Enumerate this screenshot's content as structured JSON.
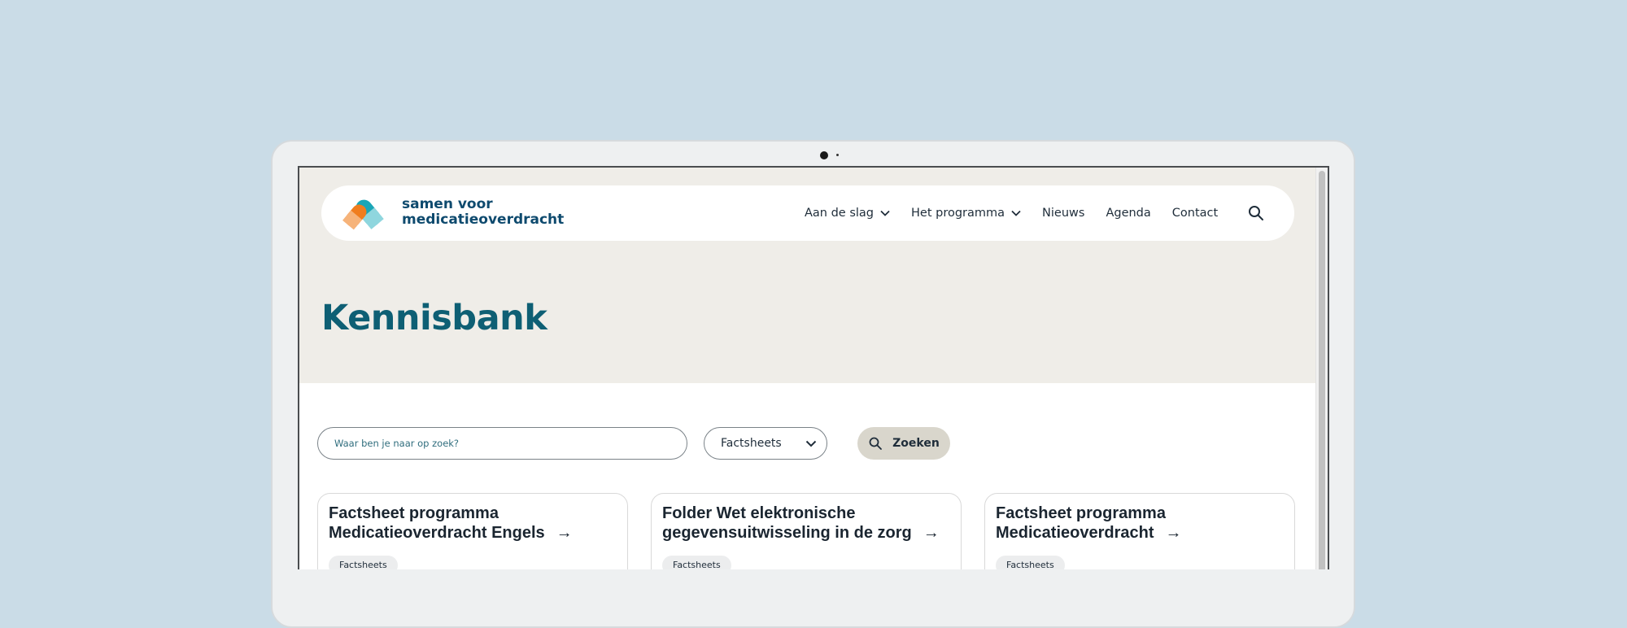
{
  "logo": {
    "line1": "samen voor",
    "line2": "medicatieoverdracht"
  },
  "nav": {
    "items": [
      {
        "label": "Aan de slag",
        "has_dropdown": true
      },
      {
        "label": "Het programma",
        "has_dropdown": true
      },
      {
        "label": "Nieuws",
        "has_dropdown": false
      },
      {
        "label": "Agenda",
        "has_dropdown": false
      },
      {
        "label": "Contact",
        "has_dropdown": false
      }
    ],
    "search_icon": "search-icon"
  },
  "page": {
    "title": "Kennisbank"
  },
  "filters": {
    "search_placeholder": "Waar ben je naar op zoek?",
    "category_selected": "Factsheets",
    "search_button": "Zoeken"
  },
  "cards": [
    {
      "line1": "Factsheet programma",
      "line2": "Medicatieoverdracht Engels",
      "badge": "Factsheets"
    },
    {
      "line1": "Folder Wet elektronische",
      "line2": "gegevensuitwisseling in de zorg",
      "badge": "Factsheets"
    },
    {
      "line1": "Factsheet programma",
      "line2": "Medicatieoverdracht",
      "badge": "Factsheets"
    }
  ],
  "colors": {
    "background": "#cadce7",
    "hero": "#efede8",
    "title": "#0e5f74",
    "logo_text": "#0e4a6e",
    "logo_orange": "#f07d1e",
    "logo_teal": "#1aa6b7",
    "button": "#d9d6cc"
  }
}
